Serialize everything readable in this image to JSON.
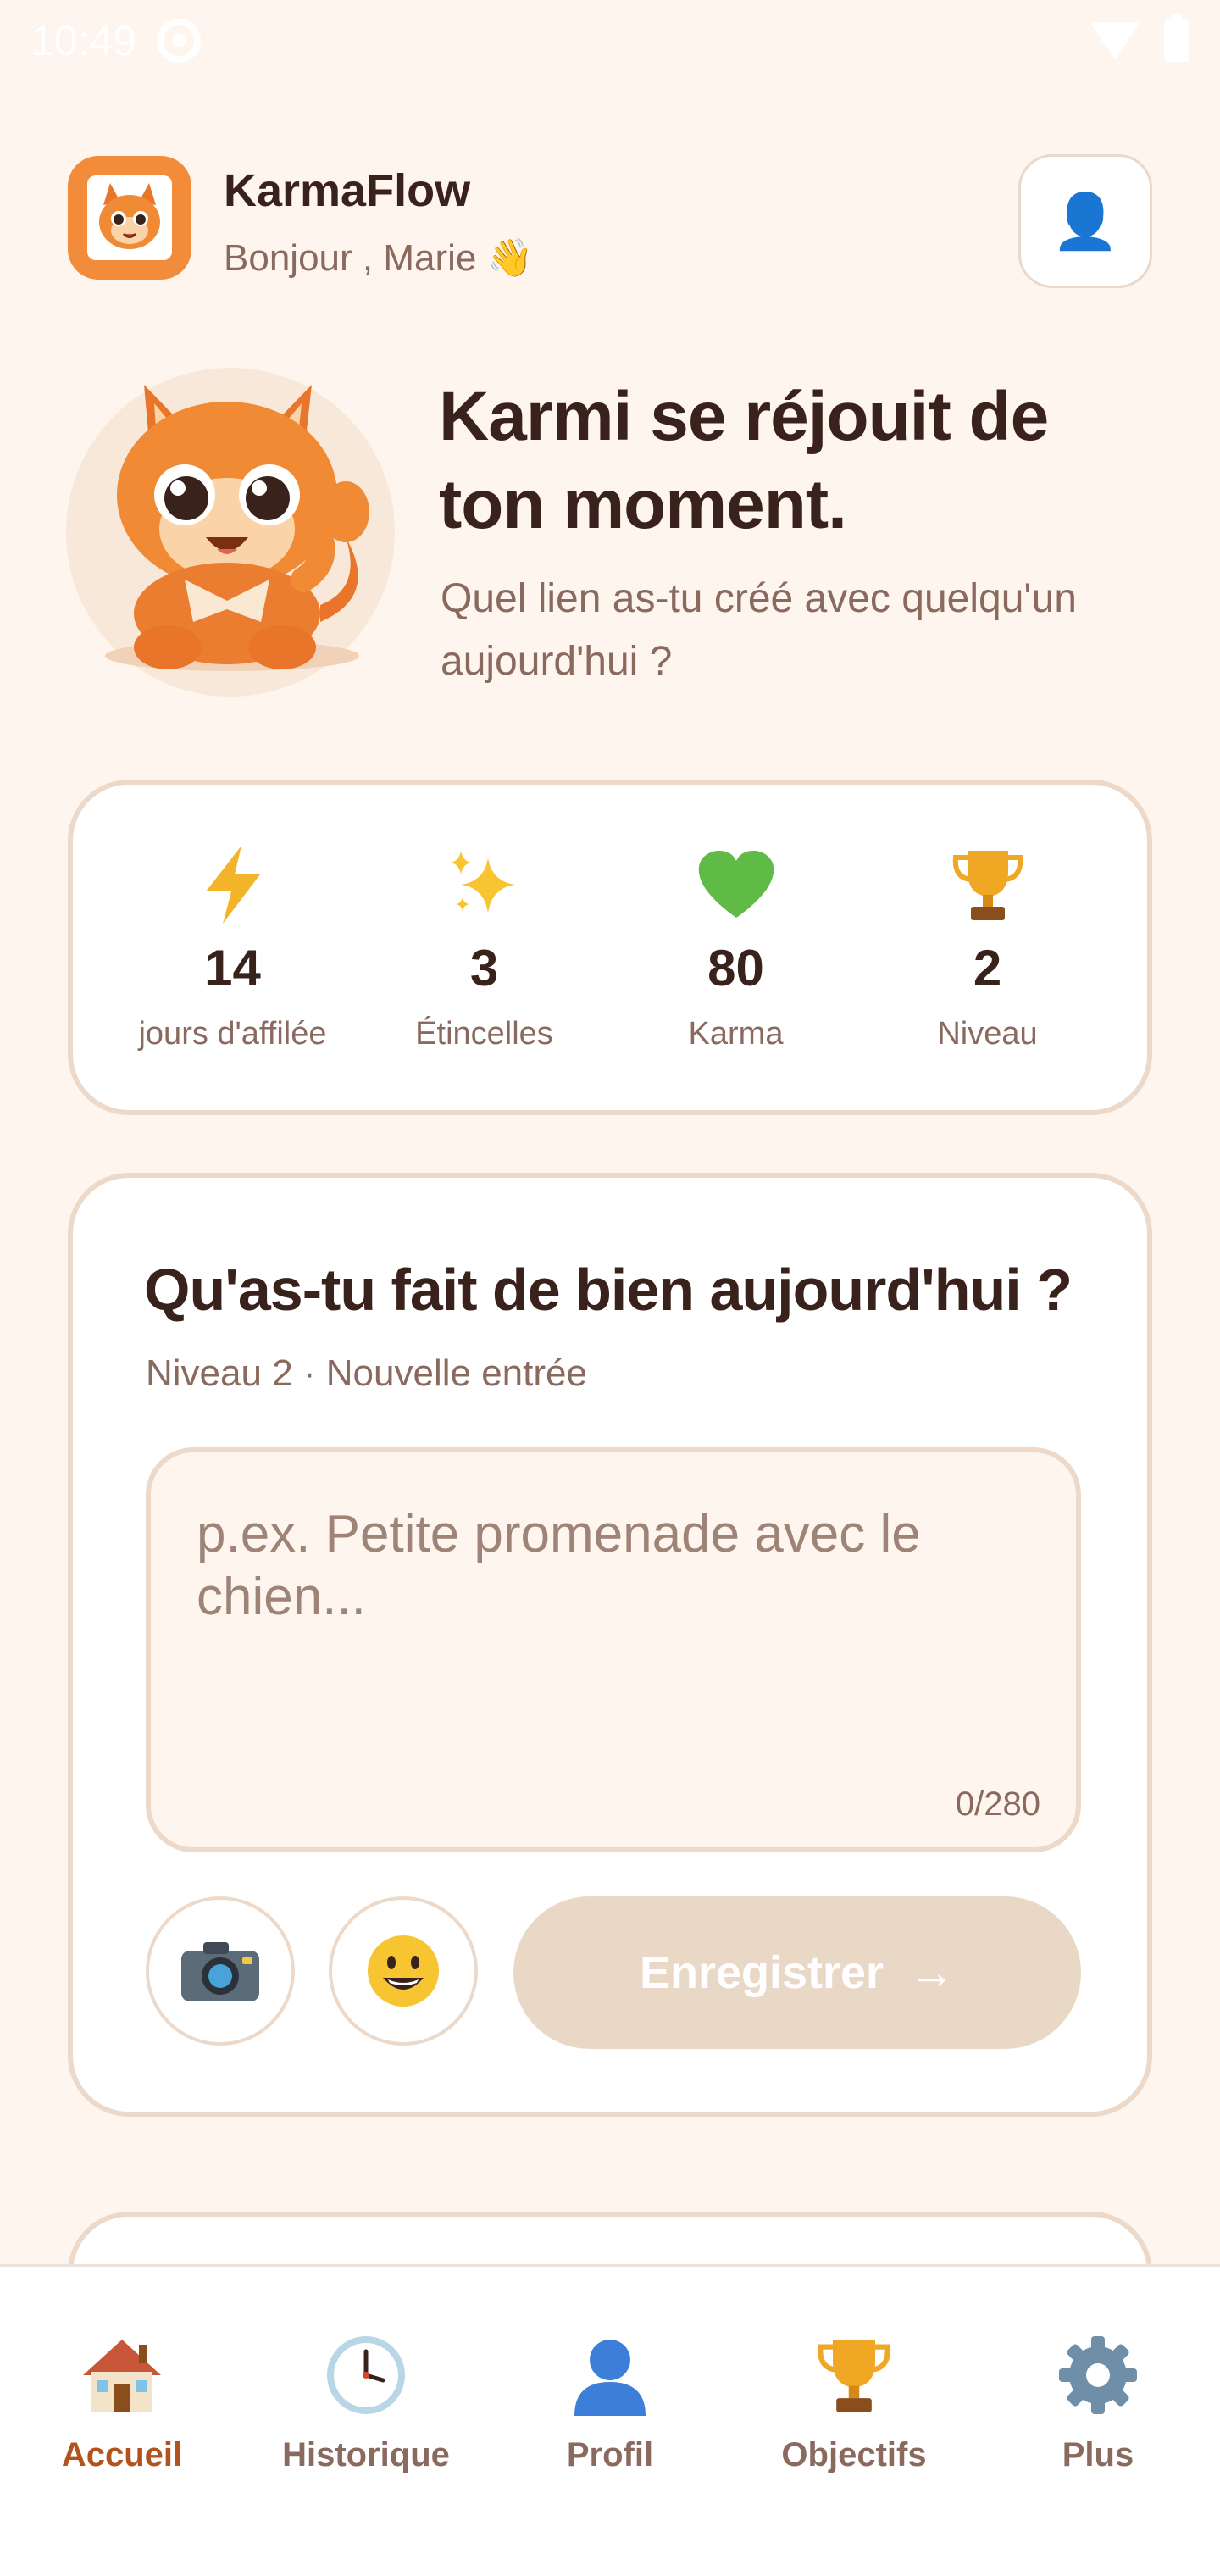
{
  "status_bar": {
    "time": "10:49"
  },
  "header": {
    "app_name": "KarmaFlow",
    "greeting": "Bonjour , Marie 👋",
    "profile_icon": "👤"
  },
  "hero": {
    "mascot": "karmi-mascot",
    "title": "Karmi se réjouit de ton moment.",
    "subtitle": "Quel lien as-tu créé avec quelqu'un aujourd'hui ?"
  },
  "stats": [
    {
      "icon": "⚡",
      "icon_name": "lightning-icon",
      "value": "14",
      "label": "jours d'affilée"
    },
    {
      "icon": "✨",
      "icon_name": "sparkles-icon",
      "value": "3",
      "label": "Étincelles"
    },
    {
      "icon": "💚",
      "icon_name": "green-heart-icon",
      "value": "80",
      "label": "Karma"
    },
    {
      "icon": "🏆",
      "icon_name": "trophy-icon",
      "value": "2",
      "label": "Niveau"
    }
  ],
  "entry": {
    "title": "Qu'as-tu fait de bien aujourd'hui ?",
    "meta": "Niveau 2 · Nouvelle entrée",
    "placeholder": "p.ex. Petite promenade avec le chien...",
    "value": "",
    "char_count": "0/280",
    "camera_icon": "📷",
    "emoji_icon": "😀",
    "save_label": "Enregistrer",
    "save_arrow": "→"
  },
  "nav": [
    {
      "label": "Accueil",
      "icon": "🏠",
      "active": true
    },
    {
      "label": "Historique",
      "icon": "🕒",
      "active": false
    },
    {
      "label": "Profil",
      "icon": "👤",
      "active": false
    },
    {
      "label": "Objectifs",
      "icon": "🏆",
      "active": false
    },
    {
      "label": "Plus",
      "icon": "⚙️",
      "active": false
    }
  ],
  "colors": {
    "background": "#fdf5ee",
    "card_border": "#ecd9c9",
    "accent": "#f28c3a",
    "active_nav": "#b4521d",
    "disabled_button": "#ead8c7"
  }
}
